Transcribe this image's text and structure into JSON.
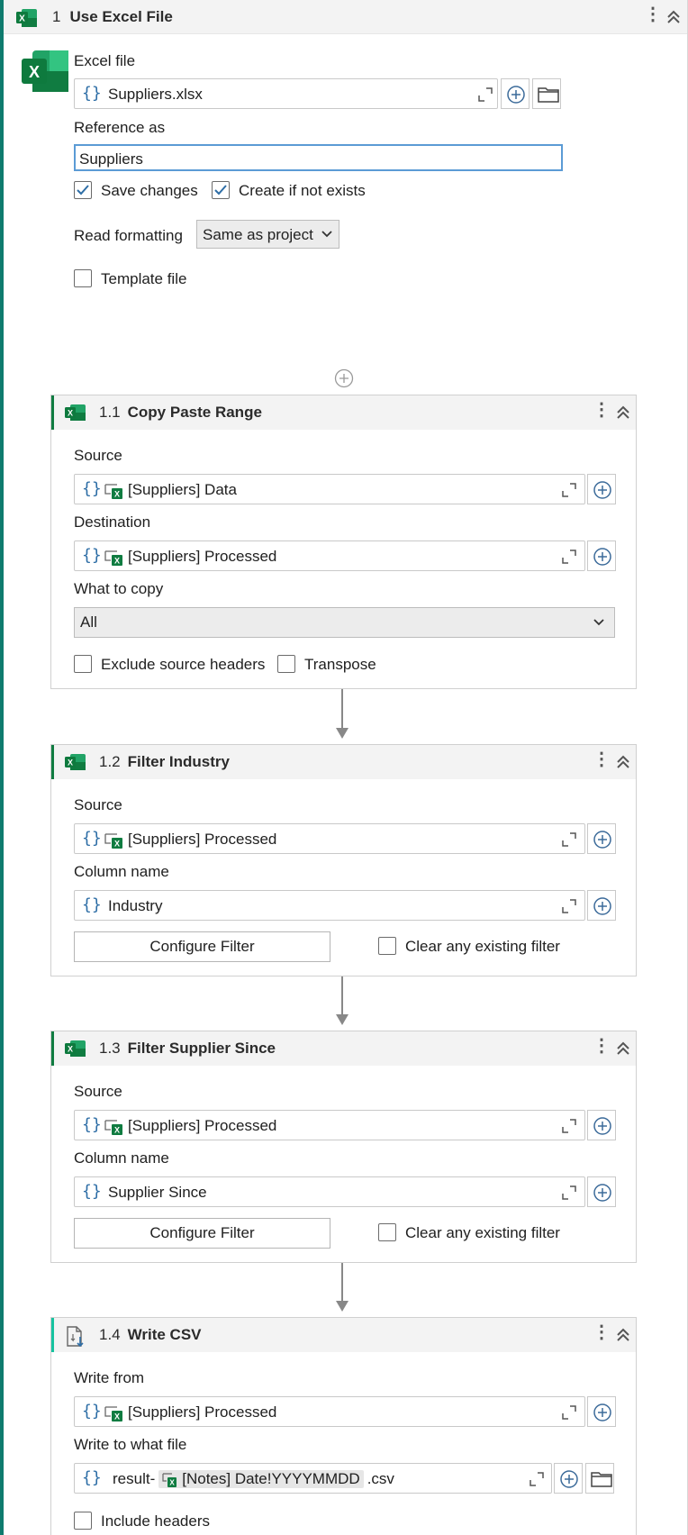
{
  "activity": {
    "number": "1",
    "title": "Use Excel File",
    "excel_file_label": "Excel file",
    "excel_file_value": "Suppliers.xlsx",
    "reference_label": "Reference as",
    "reference_value": "Suppliers",
    "save_changes_label": "Save changes",
    "save_changes_checked": true,
    "create_if_not_exists_label": "Create if not exists",
    "create_if_not_exists_checked": true,
    "read_formatting_label": "Read formatting",
    "read_formatting_value": "Same as project",
    "template_file_label": "Template file",
    "template_file_checked": false
  },
  "cards": [
    {
      "number": "1.1",
      "title": "Copy Paste Range",
      "source_label": "Source",
      "source_value": "[Suppliers] Data",
      "destination_label": "Destination",
      "destination_value": "[Suppliers] Processed",
      "what_to_copy_label": "What to copy",
      "what_to_copy_value": "All",
      "exclude_headers_label": "Exclude source headers",
      "transpose_label": "Transpose"
    },
    {
      "number": "1.2",
      "title": "Filter Industry",
      "source_label": "Source",
      "source_value": "[Suppliers] Processed",
      "column_label": "Column name",
      "column_value": "Industry",
      "configure_filter_label": "Configure Filter",
      "clear_filter_label": "Clear any existing filter"
    },
    {
      "number": "1.3",
      "title": "Filter Supplier Since",
      "source_label": "Source",
      "source_value": "[Suppliers] Processed",
      "column_label": "Column name",
      "column_value": "Supplier Since",
      "configure_filter_label": "Configure Filter",
      "clear_filter_label": "Clear any existing filter"
    },
    {
      "number": "1.4",
      "title": "Write CSV",
      "write_from_label": "Write from",
      "write_from_value": "[Suppliers] Processed",
      "write_to_label": "Write to what file",
      "write_to_prefix": "result-",
      "write_to_chip": "[Notes] Date!YYYYMMDD",
      "write_to_suffix": ".csv",
      "include_headers_label": "Include headers"
    }
  ],
  "colors": {
    "excel_green": "#107c41",
    "brace_blue": "#2e6ea6",
    "left_bar": "#0f7b6e",
    "focus_blue": "#5b9bd5"
  },
  "icons": [
    "excel-icon",
    "kebab-icon",
    "collapse-icon",
    "expand-icon",
    "add-icon",
    "folder-icon",
    "check-icon",
    "chevron-down-icon",
    "csv-icon"
  ]
}
